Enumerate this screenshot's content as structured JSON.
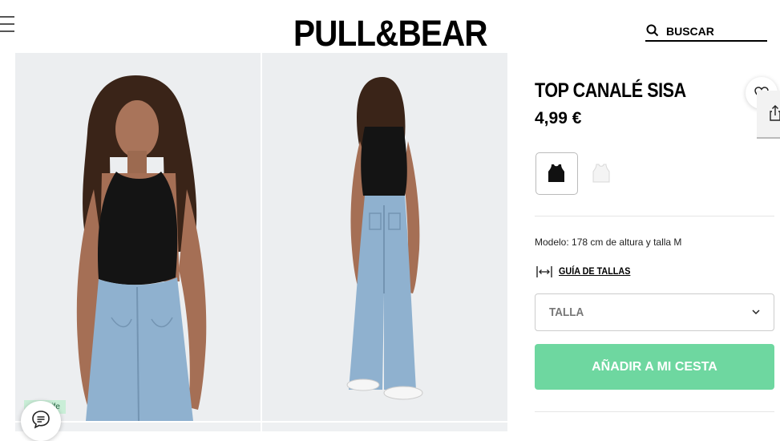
{
  "header": {
    "brand": "PULL&BEAR",
    "search_placeholder": "BUSCAR"
  },
  "gallery": {
    "badge_text": "...ife"
  },
  "product": {
    "title": "TOP CANALÉ SISA",
    "price": "4,99 €",
    "colors": [
      {
        "name": "black",
        "hex": "#111111",
        "selected": true
      },
      {
        "name": "white",
        "hex": "#f4f4f4",
        "selected": false
      }
    ],
    "model_info": "Modelo: 178 cm de altura y talla M",
    "size_guide_label": "GUÍA DE TALLAS",
    "size_select_label": "TALLA",
    "add_to_cart_label": "AÑADIR A MI CESTA"
  },
  "colors": {
    "accent_green": "#6ed7a0",
    "badge_green": "#c9eed7"
  },
  "icons": [
    "menu-icon",
    "search-icon",
    "heart-icon",
    "share-icon",
    "chat-icon",
    "ruler-icon",
    "chevron-down-icon"
  ]
}
